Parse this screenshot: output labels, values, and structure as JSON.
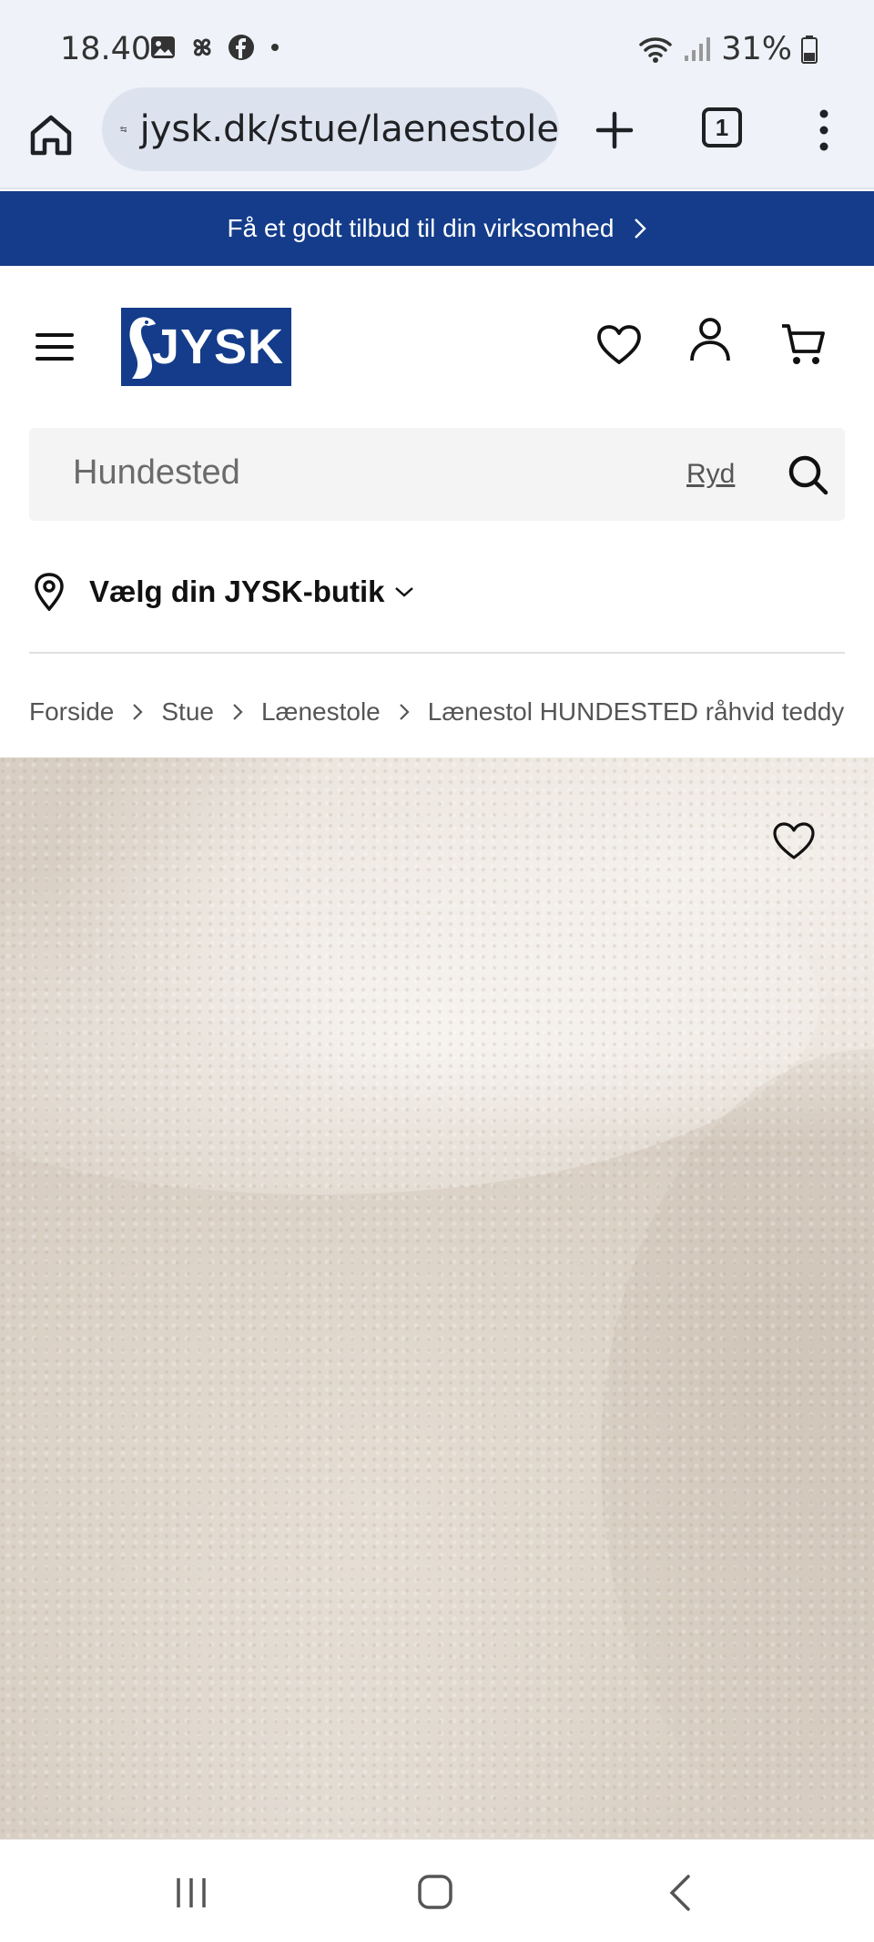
{
  "status_bar": {
    "time": "18.40",
    "battery": "31%",
    "icons_left": [
      "gallery-icon",
      "pinwheel-icon",
      "facebook-icon",
      "dot-icon"
    ],
    "icons_right": [
      "wifi-icon",
      "signal-icon",
      "battery-icon"
    ]
  },
  "browser": {
    "url": "jysk.dk/stue/laenestole",
    "tab_count": "1"
  },
  "promo": {
    "text": "Få et godt tilbud til din virksomhed"
  },
  "header": {
    "logo_text": "JYSK"
  },
  "search": {
    "value": "Hundested",
    "clear_label": "Ryd"
  },
  "store": {
    "label": "Vælg din JYSK-butik"
  },
  "breadcrumb": {
    "items": [
      "Forside",
      "Stue",
      "Lænestole",
      "Lænestol HUNDESTED råhvid teddy"
    ]
  },
  "colors": {
    "brand_blue": "#143c8a",
    "browser_bg": "#eff2f9",
    "search_bg": "#f4f4f4"
  }
}
